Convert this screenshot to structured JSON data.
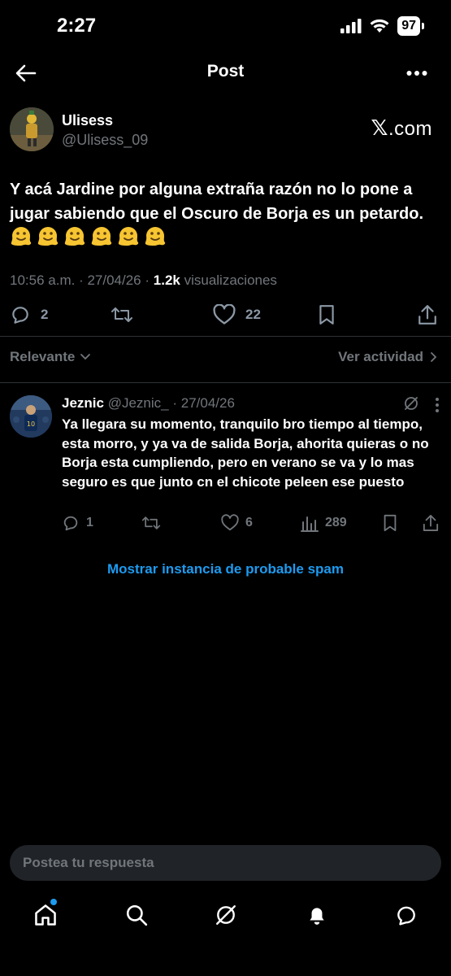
{
  "status_bar": {
    "time": "2:27",
    "battery": "97"
  },
  "header": {
    "title": "Post"
  },
  "post": {
    "author_name": "Ulisess",
    "author_handle": "@Ulisess_09",
    "source_label": ".com",
    "source_mark": "𝕏",
    "text": "Y acá Jardine por alguna extraña razón no lo pone a jugar sabiendo que el Oscuro de Borja es un petardo.",
    "emoji_count": 6,
    "time": "10:56 a.m.",
    "date": "27/04/26",
    "views": "1.2k",
    "views_label": "visualizaciones",
    "replies": "2",
    "likes": "22"
  },
  "filter": {
    "sort_label": "Relevante",
    "activity_label": "Ver actividad"
  },
  "reply": {
    "name": "Jeznic",
    "handle": "@Jeznic_",
    "date": "· 27/04/26",
    "text": "Ya llegara su momento, tranquilo bro tiempo al tiempo, esta morro, y ya va de salida Borja, ahorita quieras o no Borja esta cumpliendo, pero en verano se va y lo mas seguro es que junto cn el chicote peleen ese puesto",
    "replies": "1",
    "likes": "6",
    "views": "289"
  },
  "spam_link": "Mostrar instancia de probable spam",
  "composer": {
    "placeholder": "Postea tu respuesta"
  },
  "colors": {
    "accent": "#1d9bf0",
    "background": "#000000",
    "muted": "#71767b"
  }
}
